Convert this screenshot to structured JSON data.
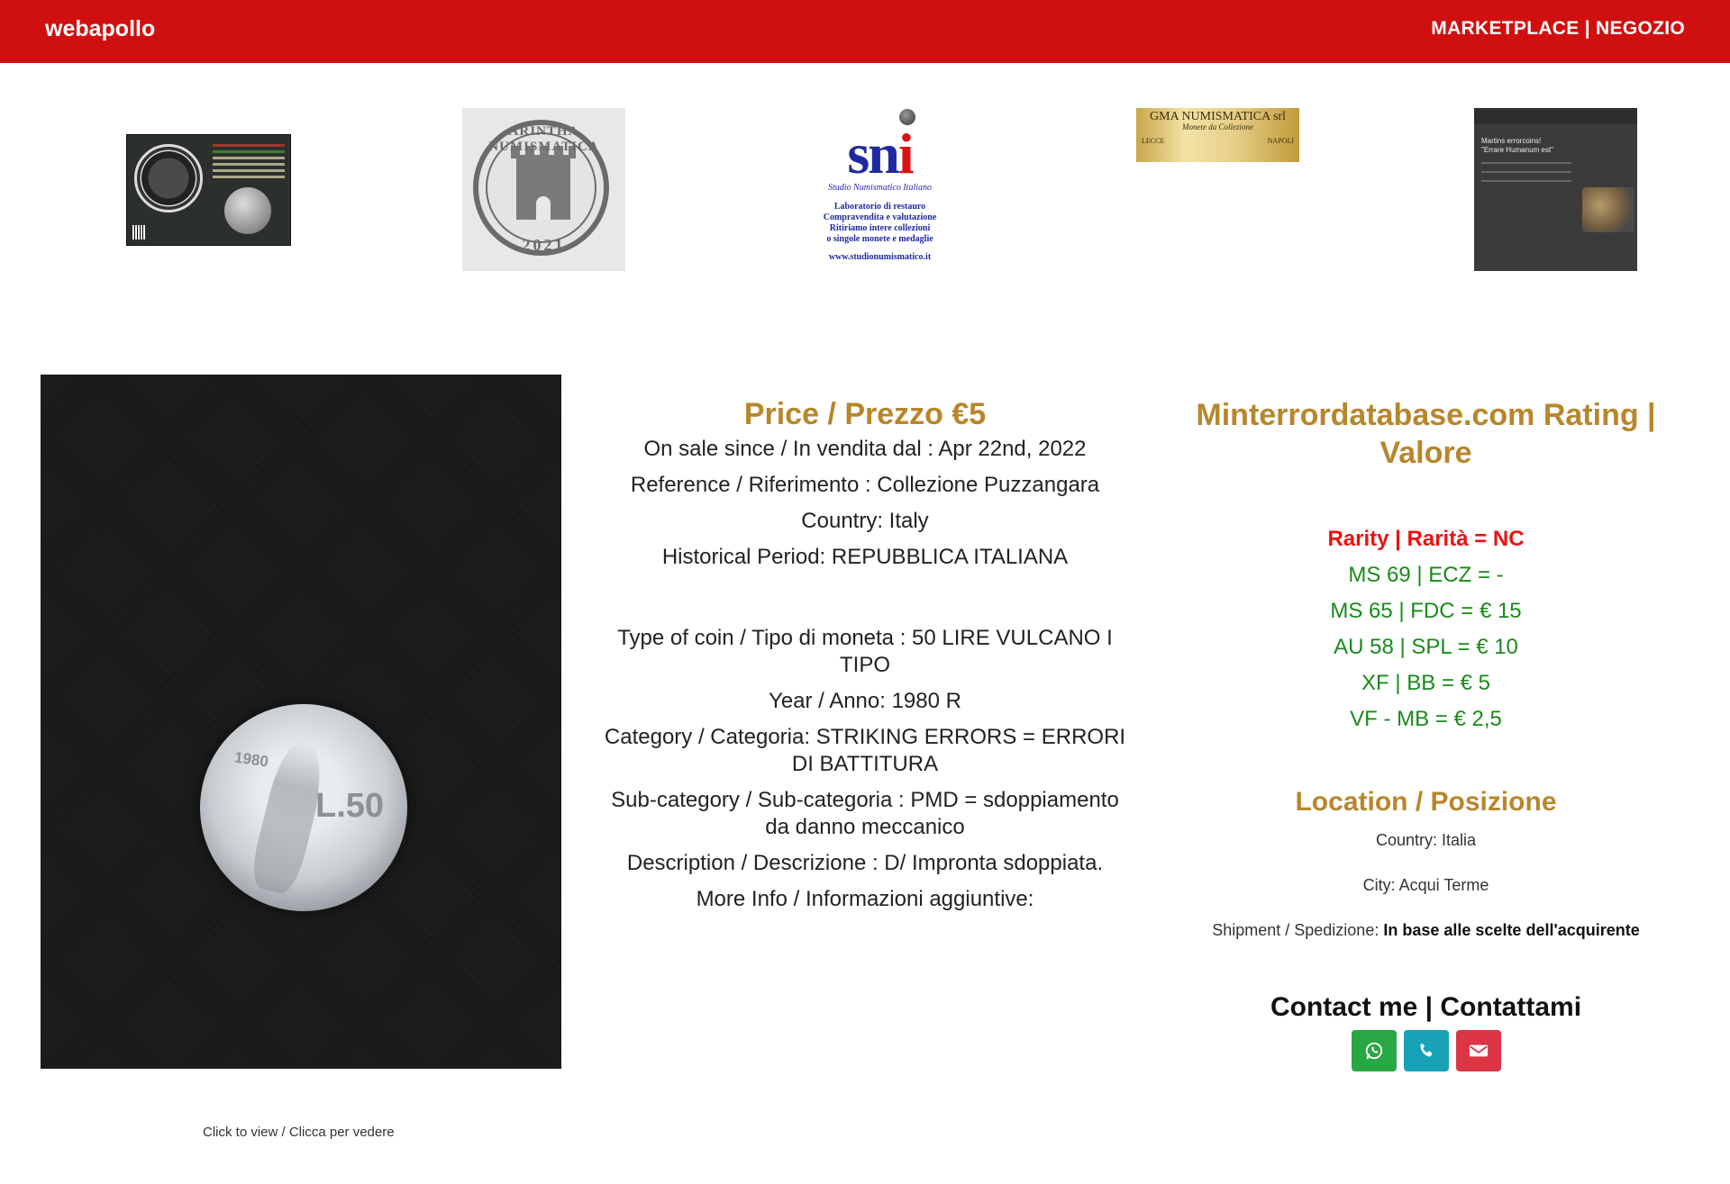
{
  "header": {
    "brand": "webapollo",
    "nav_marketplace": "MARKETPLACE",
    "nav_separator": "|",
    "nav_shop": "NEGOZIO"
  },
  "banners": {
    "b2_top": "ARINTHA NUMISMATICA",
    "b2_year": "2021",
    "b3_logo_main": "sn",
    "b3_logo_accent": "i",
    "b3_sub": "Studio Numismatico Italiano",
    "b3_lab1": "Laboratorio di restauro",
    "b3_lab2": "Compravendita e valutazione",
    "b3_lab3": "Ritiriamo intere collezioni",
    "b3_lab4": "o singole monete e medaglie",
    "b3_url": "www.studionumismatico.it",
    "b4_title": "GMA NUMISMATICA srl",
    "b4_sub": "Monete da Collezione",
    "b4_left": "LECCE",
    "b4_right": "NAPOLI",
    "b5_head1": "Martins errorcoins!",
    "b5_head2": "\"Errare Humanum est\""
  },
  "photo": {
    "coin_year": "1980",
    "coin_value": "L.50",
    "caption": "Click to view / Clicca per vedere"
  },
  "details": {
    "price": "Price / Prezzo €5",
    "on_sale": "On sale since / In vendita dal : Apr 22nd, 2022",
    "reference": "Reference / Riferimento : Collezione Puzzangara",
    "country": "Country: Italy",
    "period": "Historical Period: REPUBBLICA ITALIANA",
    "type": "Type of coin / Tipo di moneta : 50 LIRE VULCANO I TIPO",
    "year": "Year / Anno: 1980 R",
    "category": "Category / Categoria: STRIKING ERRORS = ERRORI DI BATTITURA",
    "subcategory": "Sub-category / Sub-categoria : PMD = sdoppiamento da danno meccanico",
    "description": "Description / Descrizione : D/ Impronta sdoppiata.",
    "more_info": "More Info / Informazioni aggiuntive:"
  },
  "rating": {
    "title": "Minterrordatabase.com Rating | Valore",
    "rarity": "Rarity | Rarità = NC",
    "grades": [
      "MS 69 | ECZ = -",
      "MS 65 | FDC = € 15",
      "AU 58 | SPL = € 10",
      "XF | BB = € 5",
      "VF - MB = € 2,5"
    ]
  },
  "location": {
    "title": "Location / Posizione",
    "country": "Country: Italia",
    "city": "City: Acqui Terme",
    "shipment_label": "Shipment / Spedizione:",
    "shipment_value": "In base alle scelte dell'acquirente"
  },
  "contact": {
    "title": "Contact me | Contattami",
    "buttons": [
      "whatsapp-icon",
      "phone-icon",
      "envelope-icon"
    ]
  },
  "colors": {
    "header": "#d01010",
    "gold": "#b8862b",
    "rarity": "#e11111",
    "grade": "#1a8a1a",
    "whatsapp": "#27a844",
    "phone": "#17a2b8",
    "email": "#dc3545"
  }
}
